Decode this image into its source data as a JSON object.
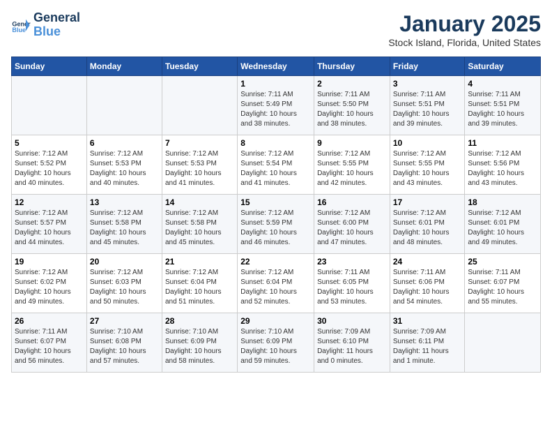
{
  "header": {
    "logo_line1": "General",
    "logo_line2": "Blue",
    "month": "January 2025",
    "location": "Stock Island, Florida, United States"
  },
  "days_of_week": [
    "Sunday",
    "Monday",
    "Tuesday",
    "Wednesday",
    "Thursday",
    "Friday",
    "Saturday"
  ],
  "weeks": [
    [
      {
        "num": "",
        "info": ""
      },
      {
        "num": "",
        "info": ""
      },
      {
        "num": "",
        "info": ""
      },
      {
        "num": "1",
        "info": "Sunrise: 7:11 AM\nSunset: 5:49 PM\nDaylight: 10 hours\nand 38 minutes."
      },
      {
        "num": "2",
        "info": "Sunrise: 7:11 AM\nSunset: 5:50 PM\nDaylight: 10 hours\nand 38 minutes."
      },
      {
        "num": "3",
        "info": "Sunrise: 7:11 AM\nSunset: 5:51 PM\nDaylight: 10 hours\nand 39 minutes."
      },
      {
        "num": "4",
        "info": "Sunrise: 7:11 AM\nSunset: 5:51 PM\nDaylight: 10 hours\nand 39 minutes."
      }
    ],
    [
      {
        "num": "5",
        "info": "Sunrise: 7:12 AM\nSunset: 5:52 PM\nDaylight: 10 hours\nand 40 minutes."
      },
      {
        "num": "6",
        "info": "Sunrise: 7:12 AM\nSunset: 5:53 PM\nDaylight: 10 hours\nand 40 minutes."
      },
      {
        "num": "7",
        "info": "Sunrise: 7:12 AM\nSunset: 5:53 PM\nDaylight: 10 hours\nand 41 minutes."
      },
      {
        "num": "8",
        "info": "Sunrise: 7:12 AM\nSunset: 5:54 PM\nDaylight: 10 hours\nand 41 minutes."
      },
      {
        "num": "9",
        "info": "Sunrise: 7:12 AM\nSunset: 5:55 PM\nDaylight: 10 hours\nand 42 minutes."
      },
      {
        "num": "10",
        "info": "Sunrise: 7:12 AM\nSunset: 5:55 PM\nDaylight: 10 hours\nand 43 minutes."
      },
      {
        "num": "11",
        "info": "Sunrise: 7:12 AM\nSunset: 5:56 PM\nDaylight: 10 hours\nand 43 minutes."
      }
    ],
    [
      {
        "num": "12",
        "info": "Sunrise: 7:12 AM\nSunset: 5:57 PM\nDaylight: 10 hours\nand 44 minutes."
      },
      {
        "num": "13",
        "info": "Sunrise: 7:12 AM\nSunset: 5:58 PM\nDaylight: 10 hours\nand 45 minutes."
      },
      {
        "num": "14",
        "info": "Sunrise: 7:12 AM\nSunset: 5:58 PM\nDaylight: 10 hours\nand 45 minutes."
      },
      {
        "num": "15",
        "info": "Sunrise: 7:12 AM\nSunset: 5:59 PM\nDaylight: 10 hours\nand 46 minutes."
      },
      {
        "num": "16",
        "info": "Sunrise: 7:12 AM\nSunset: 6:00 PM\nDaylight: 10 hours\nand 47 minutes."
      },
      {
        "num": "17",
        "info": "Sunrise: 7:12 AM\nSunset: 6:01 PM\nDaylight: 10 hours\nand 48 minutes."
      },
      {
        "num": "18",
        "info": "Sunrise: 7:12 AM\nSunset: 6:01 PM\nDaylight: 10 hours\nand 49 minutes."
      }
    ],
    [
      {
        "num": "19",
        "info": "Sunrise: 7:12 AM\nSunset: 6:02 PM\nDaylight: 10 hours\nand 49 minutes."
      },
      {
        "num": "20",
        "info": "Sunrise: 7:12 AM\nSunset: 6:03 PM\nDaylight: 10 hours\nand 50 minutes."
      },
      {
        "num": "21",
        "info": "Sunrise: 7:12 AM\nSunset: 6:04 PM\nDaylight: 10 hours\nand 51 minutes."
      },
      {
        "num": "22",
        "info": "Sunrise: 7:12 AM\nSunset: 6:04 PM\nDaylight: 10 hours\nand 52 minutes."
      },
      {
        "num": "23",
        "info": "Sunrise: 7:11 AM\nSunset: 6:05 PM\nDaylight: 10 hours\nand 53 minutes."
      },
      {
        "num": "24",
        "info": "Sunrise: 7:11 AM\nSunset: 6:06 PM\nDaylight: 10 hours\nand 54 minutes."
      },
      {
        "num": "25",
        "info": "Sunrise: 7:11 AM\nSunset: 6:07 PM\nDaylight: 10 hours\nand 55 minutes."
      }
    ],
    [
      {
        "num": "26",
        "info": "Sunrise: 7:11 AM\nSunset: 6:07 PM\nDaylight: 10 hours\nand 56 minutes."
      },
      {
        "num": "27",
        "info": "Sunrise: 7:10 AM\nSunset: 6:08 PM\nDaylight: 10 hours\nand 57 minutes."
      },
      {
        "num": "28",
        "info": "Sunrise: 7:10 AM\nSunset: 6:09 PM\nDaylight: 10 hours\nand 58 minutes."
      },
      {
        "num": "29",
        "info": "Sunrise: 7:10 AM\nSunset: 6:09 PM\nDaylight: 10 hours\nand 59 minutes."
      },
      {
        "num": "30",
        "info": "Sunrise: 7:09 AM\nSunset: 6:10 PM\nDaylight: 11 hours\nand 0 minutes."
      },
      {
        "num": "31",
        "info": "Sunrise: 7:09 AM\nSunset: 6:11 PM\nDaylight: 11 hours\nand 1 minute."
      },
      {
        "num": "",
        "info": ""
      }
    ]
  ]
}
